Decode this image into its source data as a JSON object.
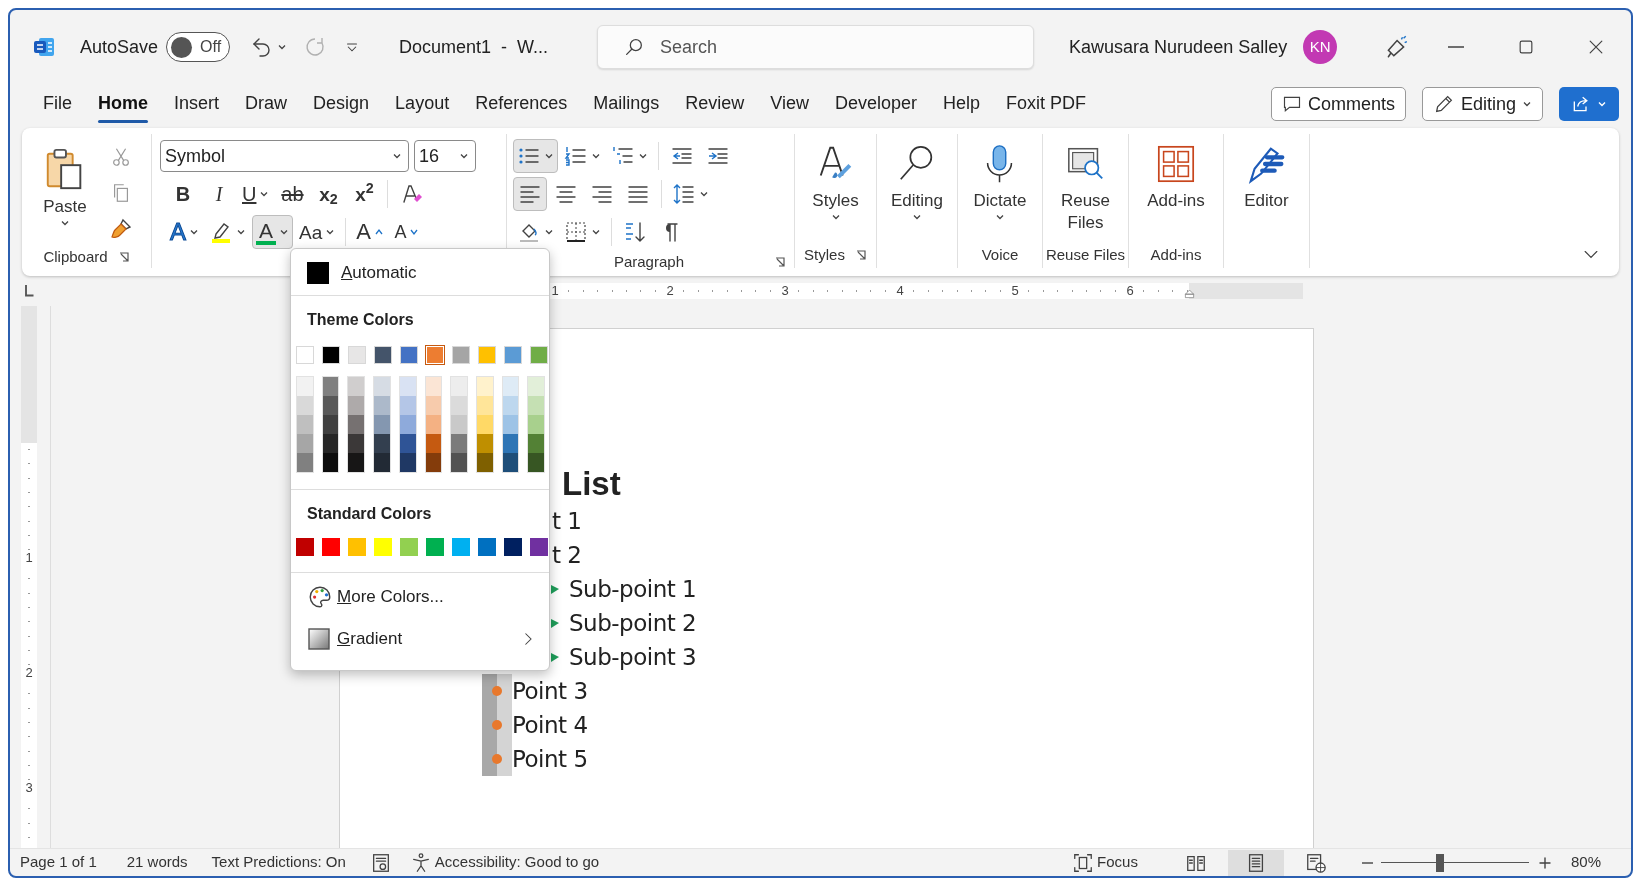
{
  "title_bar": {
    "autosave_label": "AutoSave",
    "autosave_on": false,
    "autosave_state": "Off",
    "document_title": "Document1  -  W...",
    "search_placeholder": "Search",
    "user_name": "Kawusara Nurudeen Salley",
    "avatar_initials": "KN"
  },
  "tabs": [
    {
      "label": "File",
      "selected": false
    },
    {
      "label": "Home",
      "selected": true
    },
    {
      "label": "Insert",
      "selected": false
    },
    {
      "label": "Draw",
      "selected": false
    },
    {
      "label": "Design",
      "selected": false
    },
    {
      "label": "Layout",
      "selected": false
    },
    {
      "label": "References",
      "selected": false
    },
    {
      "label": "Mailings",
      "selected": false
    },
    {
      "label": "Review",
      "selected": false
    },
    {
      "label": "View",
      "selected": false
    },
    {
      "label": "Developer",
      "selected": false
    },
    {
      "label": "Help",
      "selected": false
    },
    {
      "label": "Foxit PDF",
      "selected": false
    }
  ],
  "header_buttons": {
    "comments": "Comments",
    "editing": "Editing"
  },
  "ribbon": {
    "clipboard": {
      "paste": "Paste",
      "group_label": "Clipboard"
    },
    "font": {
      "font_name": "Symbol",
      "font_size": "16",
      "format_buttons": [
        {
          "kind": "bold",
          "label": "B",
          "dropdown": false
        },
        {
          "kind": "italic",
          "label": "I",
          "dropdown": false
        },
        {
          "kind": "underline",
          "label": "U",
          "dropdown": true
        },
        {
          "kind": "strikethrough",
          "label": "ab",
          "dropdown": false
        },
        {
          "kind": "subscript",
          "label": "x$_{2}$",
          "dropdown": false
        },
        {
          "kind": "superscript",
          "label": "x$^{2}$",
          "dropdown": false
        },
        {
          "kind": "clear",
          "dropdown": false
        }
      ],
      "effect_buttons": [
        {
          "kind": "text_effects",
          "label": "A",
          "dropdown": true,
          "selected": false
        },
        {
          "kind": "highlight",
          "dropdown": true,
          "selected": false
        },
        {
          "kind": "font_color",
          "label": "A",
          "dropdown": true,
          "selected": true
        },
        {
          "kind": "change_case",
          "label": "Aa",
          "dropdown": true,
          "selected": false
        },
        {
          "kind": "grow",
          "label": "A",
          "dropdown": false,
          "selected": false
        },
        {
          "kind": "shrink",
          "label": "A",
          "dropdown": false,
          "selected": false
        }
      ]
    },
    "paragraph": {
      "group_label": "Paragraph",
      "rows": [
        [
          {
            "kind": "bullets",
            "selected": true,
            "dropdown": true
          },
          {
            "kind": "numbering",
            "selected": false,
            "dropdown": true
          },
          {
            "kind": "multilevel",
            "selected": false,
            "dropdown": true
          },
          {
            "kind": "outdent",
            "selected": false,
            "dropdown": false
          },
          {
            "kind": "indent",
            "selected": false,
            "dropdown": false
          }
        ],
        [
          {
            "kind": "align_left",
            "selected": true,
            "dropdown": false
          },
          {
            "kind": "align_center",
            "selected": false,
            "dropdown": false
          },
          {
            "kind": "align_right",
            "selected": false,
            "dropdown": false
          },
          {
            "kind": "justify",
            "selected": false,
            "dropdown": false
          },
          {
            "kind": "line_spacing",
            "selected": false,
            "dropdown": true
          }
        ],
        [
          {
            "kind": "shading",
            "selected": false,
            "dropdown": true
          },
          {
            "kind": "borders",
            "selected": false,
            "dropdown": true
          },
          {
            "kind": "sort",
            "selected": false,
            "dropdown": false
          },
          {
            "kind": "show_marks",
            "selected": false,
            "dropdown": false
          }
        ]
      ]
    },
    "large_groups": [
      {
        "kind": "styles",
        "label": "Styles",
        "dropdown": true,
        "group_label": "Styles",
        "launcher": true
      },
      {
        "kind": "editing",
        "label": "Editing",
        "dropdown": true,
        "launcher": false
      },
      {
        "kind": "dictate",
        "label": "Dictate",
        "dropdown": true,
        "group_label": "Voice",
        "launcher": false
      },
      {
        "kind": "reuse",
        "label": "Reuse Files",
        "dropdown": false,
        "group_label": "Reuse Files",
        "launcher": false
      },
      {
        "kind": "addins",
        "label": "Add-ins",
        "dropdown": false,
        "group_label": "Add-ins",
        "launcher": false
      },
      {
        "kind": "editor",
        "label": "Editor",
        "dropdown": false,
        "launcher": false
      }
    ]
  },
  "ruler": {
    "horizontal": [
      "1",
      "2",
      "3",
      "4",
      "5",
      "6"
    ],
    "vertical": [
      "1",
      "2",
      "3"
    ]
  },
  "document": {
    "heading": "List",
    "items": [
      {
        "kind": "clipped",
        "text": "t 1"
      },
      {
        "kind": "clipped",
        "text": "t 2"
      },
      {
        "kind": "sub",
        "text": "Sub-point 1"
      },
      {
        "kind": "sub",
        "text": "Sub-point 2"
      },
      {
        "kind": "sub",
        "text": "Sub-point 3"
      },
      {
        "kind": "point",
        "text": "Point 3"
      },
      {
        "kind": "point",
        "text": "Point 4"
      },
      {
        "kind": "point",
        "text": "Point 5"
      }
    ]
  },
  "color_menu": {
    "automatic": "Automatic",
    "theme_heading": "Theme Colors",
    "theme_colors": [
      {
        "color": "#ffffff",
        "selected": false
      },
      {
        "color": "#000000",
        "selected": false
      },
      {
        "color": "#e7e6e6",
        "selected": false
      },
      {
        "color": "#44546a",
        "selected": false
      },
      {
        "color": "#4472c4",
        "selected": false
      },
      {
        "color": "#ed7d31",
        "selected": true
      },
      {
        "color": "#a5a5a5",
        "selected": false
      },
      {
        "color": "#ffc000",
        "selected": false
      },
      {
        "color": "#5b9bd5",
        "selected": false
      },
      {
        "color": "#70ad47",
        "selected": false
      }
    ],
    "theme_shade_columns": [
      [
        {
          "color": "#f2f2f2"
        },
        {
          "color": "#d9d9d9"
        },
        {
          "color": "#bfbfbf"
        },
        {
          "color": "#a6a6a6"
        },
        {
          "color": "#808080"
        }
      ],
      [
        {
          "color": "#808080"
        },
        {
          "color": "#595959"
        },
        {
          "color": "#404040"
        },
        {
          "color": "#262626"
        },
        {
          "color": "#0d0d0d"
        }
      ],
      [
        {
          "color": "#d0cece"
        },
        {
          "color": "#aeaaaa"
        },
        {
          "color": "#767171"
        },
        {
          "color": "#3b3838"
        },
        {
          "color": "#171616"
        }
      ],
      [
        {
          "color": "#d6dce4"
        },
        {
          "color": "#acb9ca"
        },
        {
          "color": "#8497b0"
        },
        {
          "color": "#333f4f"
        },
        {
          "color": "#222a35"
        }
      ],
      [
        {
          "color": "#d9e2f3"
        },
        {
          "color": "#b4c6e7"
        },
        {
          "color": "#8eaadb"
        },
        {
          "color": "#2f5496"
        },
        {
          "color": "#1f3864"
        }
      ],
      [
        {
          "color": "#fbe5d5"
        },
        {
          "color": "#f7cbac"
        },
        {
          "color": "#f4b183"
        },
        {
          "color": "#c55a11"
        },
        {
          "color": "#843c0b"
        }
      ],
      [
        {
          "color": "#ededed"
        },
        {
          "color": "#dbdbdb"
        },
        {
          "color": "#c9c9c9"
        },
        {
          "color": "#7b7b7b"
        },
        {
          "color": "#525252"
        }
      ],
      [
        {
          "color": "#fff2cc"
        },
        {
          "color": "#ffe599"
        },
        {
          "color": "#ffd966"
        },
        {
          "color": "#bf8f00"
        },
        {
          "color": "#7f6000"
        }
      ],
      [
        {
          "color": "#deebf6"
        },
        {
          "color": "#bdd7ee"
        },
        {
          "color": "#9dc3e6"
        },
        {
          "color": "#2e75b5"
        },
        {
          "color": "#1e4e79"
        }
      ],
      [
        {
          "color": "#e2efd9"
        },
        {
          "color": "#c5e0b3"
        },
        {
          "color": "#a8d08d"
        },
        {
          "color": "#538135"
        },
        {
          "color": "#375623"
        }
      ]
    ],
    "standard_heading": "Standard Colors",
    "standard_colors": [
      {
        "color": "#c00000"
      },
      {
        "color": "#ff0000"
      },
      {
        "color": "#ffc000"
      },
      {
        "color": "#ffff00"
      },
      {
        "color": "#92d050"
      },
      {
        "color": "#00b050"
      },
      {
        "color": "#00b0f0"
      },
      {
        "color": "#0070c0"
      },
      {
        "color": "#002060"
      },
      {
        "color": "#7030a0"
      }
    ],
    "more_colors": "More Colors...",
    "gradient": "Gradient"
  },
  "status_bar": {
    "page": "Page 1 of 1",
    "words": "21 words",
    "text_predictions": "Text Predictions: On",
    "accessibility": "Accessibility: Good to go",
    "focus": "Focus",
    "views": [
      {
        "kind": "read",
        "selected": false
      },
      {
        "kind": "print",
        "selected": true
      },
      {
        "kind": "web",
        "selected": false
      }
    ],
    "zoom": {
      "level": 0.4,
      "reading": "80%"
    }
  }
}
